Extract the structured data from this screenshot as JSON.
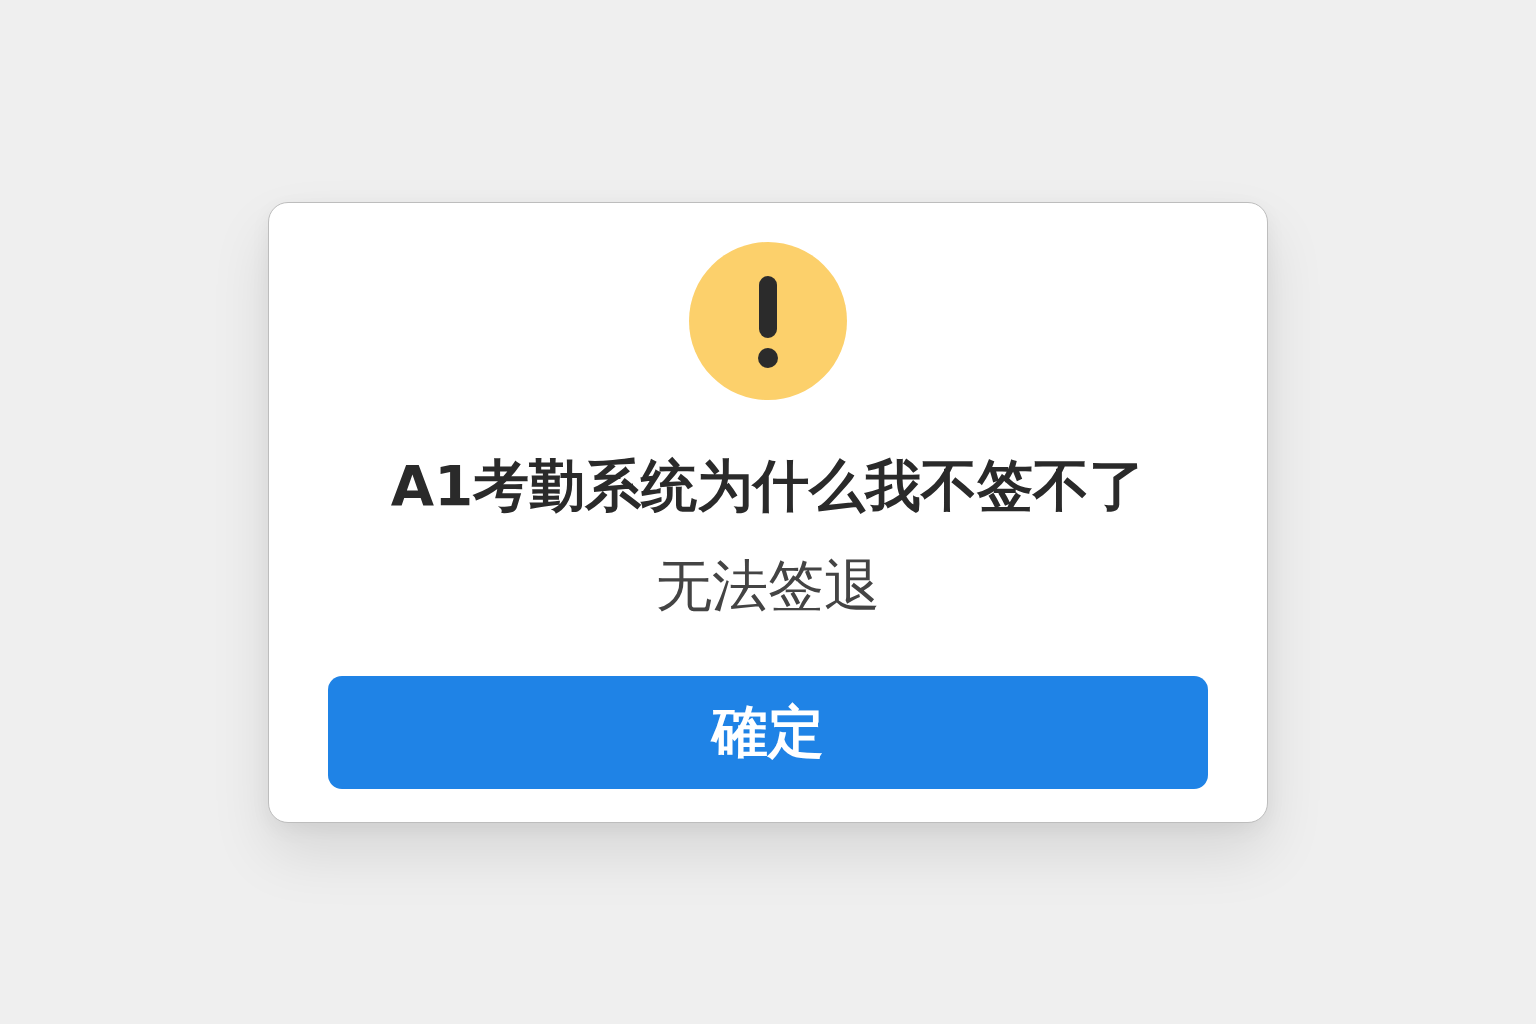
{
  "dialog": {
    "title": "A1考勤系统为什么我不签不了",
    "message": "无法签退",
    "buttons": [
      {
        "label": "確定"
      }
    ]
  }
}
